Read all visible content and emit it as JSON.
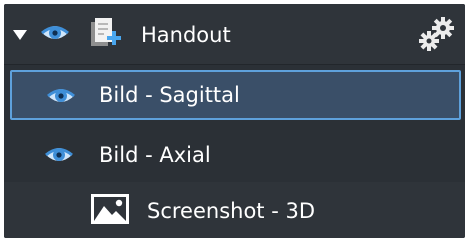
{
  "layers_panel": {
    "group": {
      "label": "Handout",
      "expanded": true,
      "icons": {
        "toggle": "expand-triangle-icon",
        "visibility": "eye-icon",
        "type": "document-add-icon",
        "settings": "gears-icon"
      }
    },
    "items": [
      {
        "label": "Bild - Sagittal",
        "icon": "eye-icon",
        "selected": true
      },
      {
        "label": "Bild - Axial",
        "icon": "eye-icon",
        "selected": false
      },
      {
        "label": "Screenshot - 3D",
        "icon": "image-icon",
        "selected": false
      }
    ]
  },
  "colors": {
    "panel_bg": "#2b3036",
    "header_bg": "#2f343a",
    "selected_bg": "#3a4f68",
    "selected_border": "#5ea1dc",
    "eye_blue": "#3f8fd8",
    "text": "#ffffff"
  }
}
